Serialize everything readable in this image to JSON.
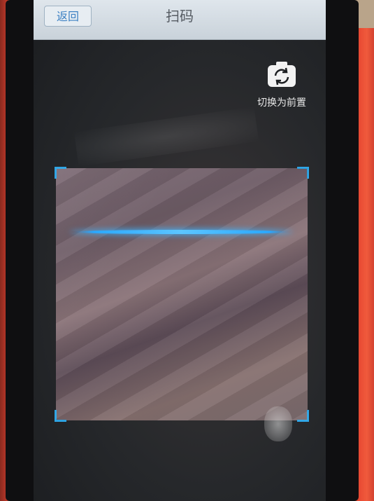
{
  "header": {
    "back_label": "返回",
    "title": "扫码"
  },
  "camera": {
    "switch_label": "切换为前置",
    "icon": "camera-switch-icon"
  },
  "colors": {
    "accent": "#2aa8ff",
    "header_bg": "#d4dce3",
    "back_text": "#3e82c4"
  }
}
